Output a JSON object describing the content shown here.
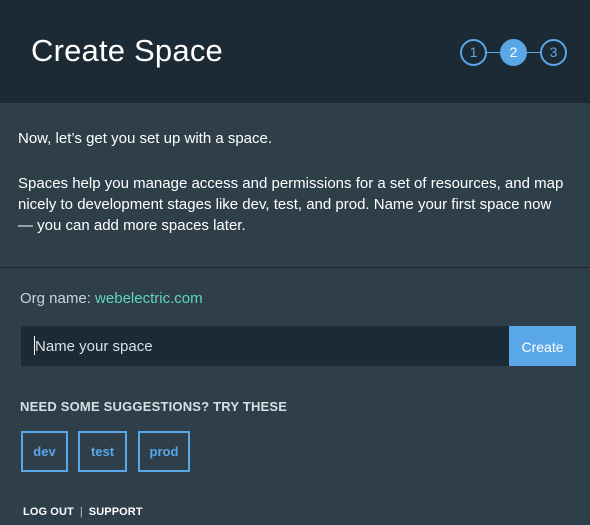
{
  "header": {
    "title": "Create Space",
    "steps": [
      {
        "label": "1",
        "state": "inactive"
      },
      {
        "label": "2",
        "state": "active"
      },
      {
        "label": "3",
        "state": "inactive"
      }
    ]
  },
  "intro": {
    "line1": "Now, let’s get you set up with a space.",
    "line2": "Spaces help you manage access and permissions for a set of resources, and map nicely to development stages like dev, test, and prod. Name your first space now — you can add more spaces later."
  },
  "org": {
    "label": "Org name:",
    "value": "webelectric.com"
  },
  "space_form": {
    "placeholder": "Name your space",
    "value": "",
    "create_label": "Create"
  },
  "suggestions": {
    "heading": "NEED SOME SUGGESTIONS? TRY THESE",
    "chips": [
      "dev",
      "test",
      "prod"
    ]
  },
  "footer": {
    "logout_label": "LOG OUT",
    "separator": "|",
    "support_label": "SUPPORT"
  },
  "colors": {
    "header_bg": "#1b2a35",
    "body_bg": "#2f3f4a",
    "accent": "#5aa7e8",
    "org_link": "#5fd4c2"
  }
}
